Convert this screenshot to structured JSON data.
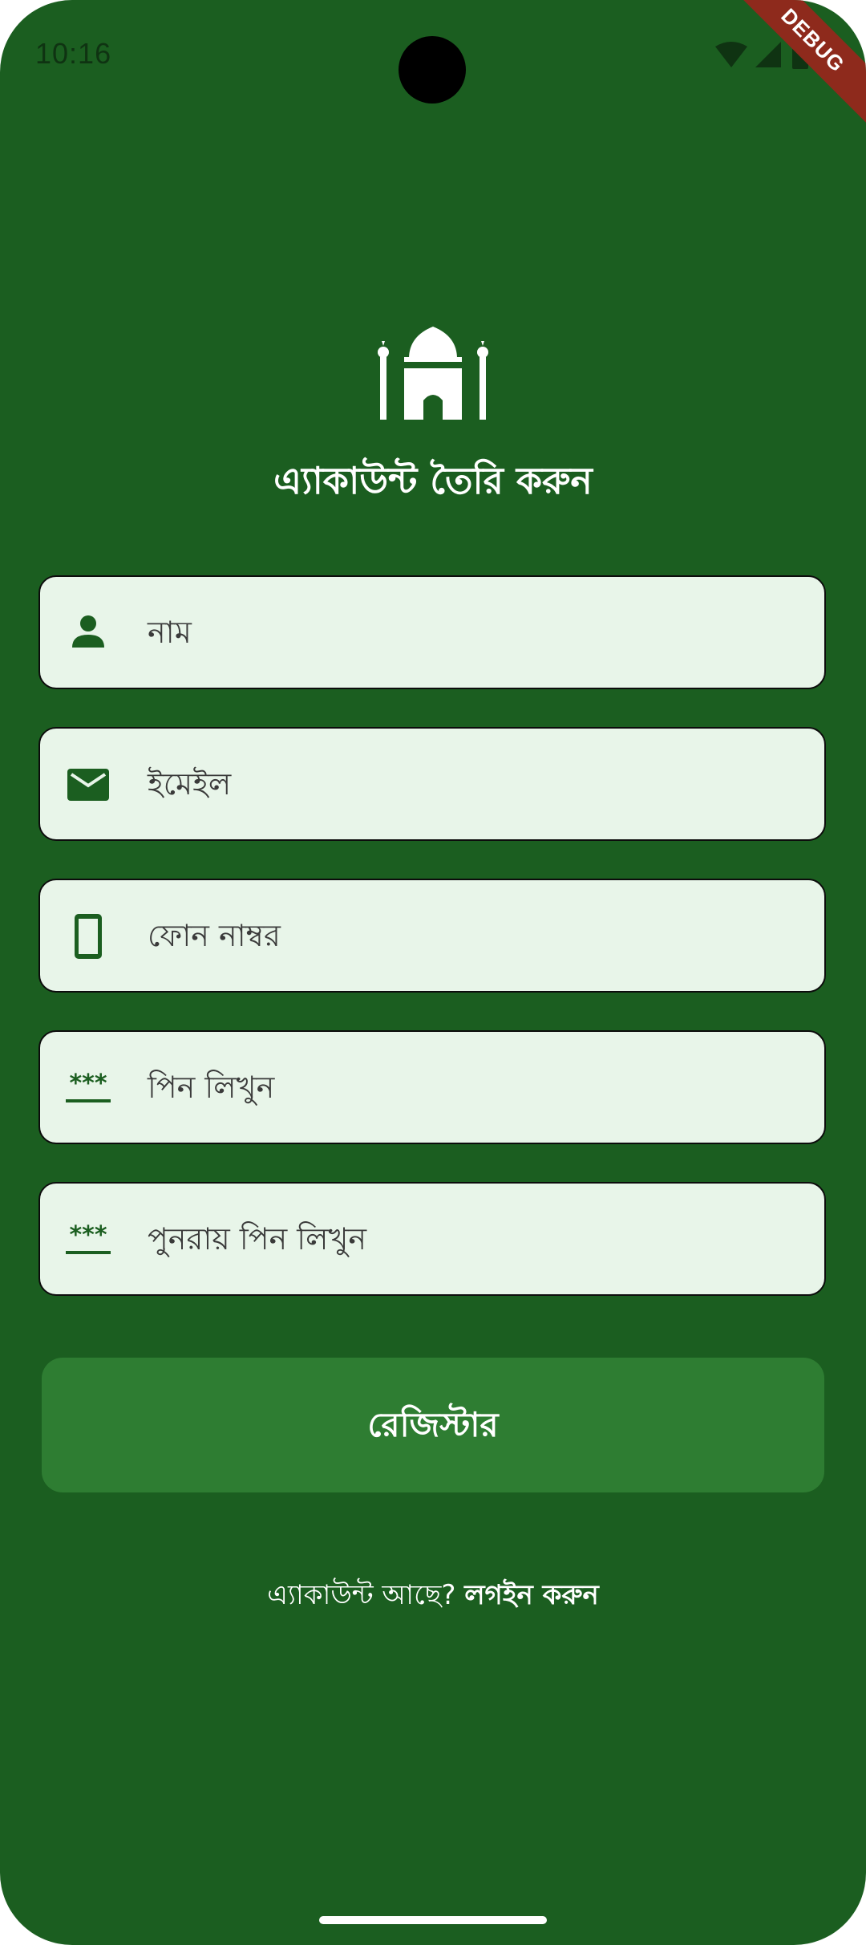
{
  "status_bar": {
    "time": "10:16",
    "icons": [
      "wifi-icon",
      "signal-icon",
      "battery-icon"
    ]
  },
  "debug_banner": "DEBUG",
  "header": {
    "logo_icon": "mosque-icon",
    "title": "এ্যাকাউন্ট তৈরি করুন"
  },
  "form": {
    "name": {
      "icon": "person-icon",
      "placeholder": "নাম"
    },
    "email": {
      "icon": "email-icon",
      "placeholder": "ইমেইল"
    },
    "phone": {
      "icon": "phone-icon",
      "placeholder": "ফোন নাম্বর"
    },
    "pin": {
      "icon": "pin-icon",
      "placeholder": "পিন লিখুন"
    },
    "pin_confirm": {
      "icon": "pin-icon",
      "placeholder": "পুনরায় পিন লিখুন"
    }
  },
  "register_button": {
    "label": "রেজিস্টার"
  },
  "footer": {
    "prompt": "এ্যাকাউন্ট আছে?",
    "link": "লগইন করুন"
  },
  "colors": {
    "background": "#1b5e20",
    "field_fill": "#e8f5e9",
    "button": "#2e7d32",
    "icon": "#1b5e20",
    "debug_banner": "#8e2a1c"
  }
}
